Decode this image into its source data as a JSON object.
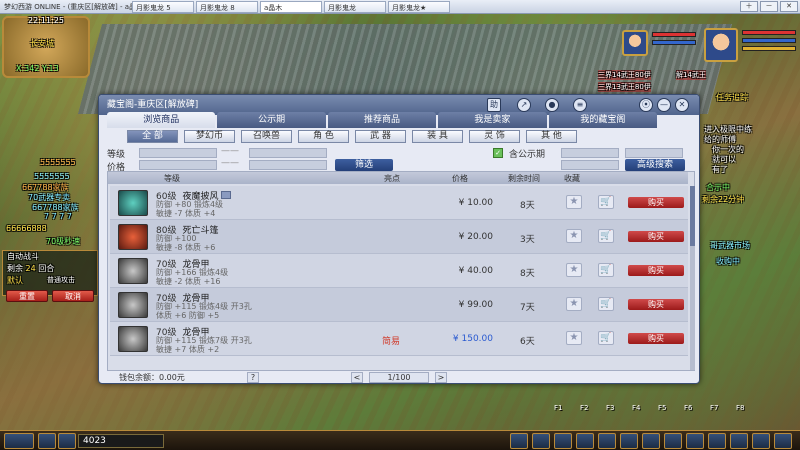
{
  "window": {
    "app_title": "梦幻西游 ONLINE - (重庆区[解放碑] - a晶木[14932600])",
    "tabs": [
      "月影鬼龙 5",
      "月影鬼龙 8",
      "a晶木",
      "月影鬼龙",
      "月影鬼龙★"
    ],
    "active_tab_index": 2,
    "controls": [
      "＋",
      "－",
      "✕"
    ]
  },
  "hud": {
    "clock": "22:11:25",
    "location": "长安城",
    "coords": "X:342 Y:13",
    "left_chat": [
      "5555555",
      "5555555",
      "667788家族",
      "70武器专卖",
      "667788家族",
      "7 7 7 7",
      "66666888",
      "70级秒速"
    ],
    "battle": {
      "auto_label": "自动战斗",
      "remaining_label": "剩余",
      "remaining_rounds": "24",
      "round_label": "回合",
      "act_label": "默认",
      "mode": "普通攻击",
      "reset_button": "重置",
      "cancel_button": "取消"
    },
    "right_texts": [
      "任务追踪",
      "进入极限中练",
      "给的师傅",
      "你一次的",
      "就可以",
      "有了",
      "合示中",
      "剩余22分钟",
      "哥武器市场",
      "收购中"
    ],
    "teams": [
      "三界14武王80伊",
      "三界13武王80伊"
    ],
    "team_right": "解14武王"
  },
  "shop": {
    "title": "藏宝阁-重庆区[解放碑]",
    "controls": [
      "助",
      "↗",
      "●",
      "≡",
      "⦿",
      "—",
      "✕"
    ],
    "tabs": [
      "浏览商品",
      "公示期",
      "推荐商品",
      "我是卖家",
      "我的藏宝阁"
    ],
    "active_tab": 0,
    "categories": [
      "全 部",
      "梦幻币",
      "召唤兽",
      "角 色",
      "武 器",
      "装 具",
      "灵 饰",
      "其 他"
    ],
    "active_category": 0,
    "filter": {
      "level_label": "等级",
      "price_label": "价格",
      "dash": "——",
      "filter_button": "筛选",
      "public_label": "含公示期",
      "advanced_button": "高级搜索"
    },
    "columns": [
      "等级",
      "亮点",
      "价格",
      "剩余时间",
      "收藏"
    ],
    "items": [
      {
        "level": "60级",
        "name": "夜魔披风",
        "line1": "防御 +80  锻炼4级",
        "line2": "敏捷 -7  体质 +4",
        "special": "",
        "price": "¥ 10.00",
        "time": "8天",
        "buy": "购买",
        "icon_class": "i1"
      },
      {
        "level": "80级",
        "name": "死亡斗篷",
        "line1": "防御 +100",
        "line2": "敏捷 -8  体质 +6",
        "special": "",
        "price": "¥ 20.00",
        "time": "3天",
        "buy": "购买",
        "icon_class": "i2"
      },
      {
        "level": "70级",
        "name": "龙骨甲",
        "line1": "防御 +166  锻炼4级",
        "line2": "敏捷 -2  体质 +16",
        "special": "",
        "price": "¥ 40.00",
        "time": "8天",
        "buy": "购买",
        "icon_class": "i3"
      },
      {
        "level": "70级",
        "name": "龙骨甲",
        "line1": "防御 +115  锻炼4级  开3孔",
        "line2": "体质 +6  防御 +5",
        "special": "",
        "price": "¥ 99.00",
        "time": "7天",
        "buy": "购买",
        "icon_class": "i3"
      },
      {
        "level": "70级",
        "name": "龙骨甲",
        "line1": "防御 +115  锻炼7级  开3孔",
        "line2": "敏捷 +7  体质 +2",
        "special": "简易",
        "price": "¥ 150.00",
        "time": "6天",
        "buy": "购买",
        "icon_class": "i3"
      }
    ],
    "footer": {
      "balance_label": "钱包余额：0.00元",
      "help": "?",
      "prev": "<",
      "page": "1/100",
      "next": ">"
    }
  },
  "bottom": {
    "money": "4023",
    "fkeys": [
      "F1",
      "F2",
      "F3",
      "F4",
      "F5",
      "F6",
      "F7",
      "F8"
    ]
  }
}
